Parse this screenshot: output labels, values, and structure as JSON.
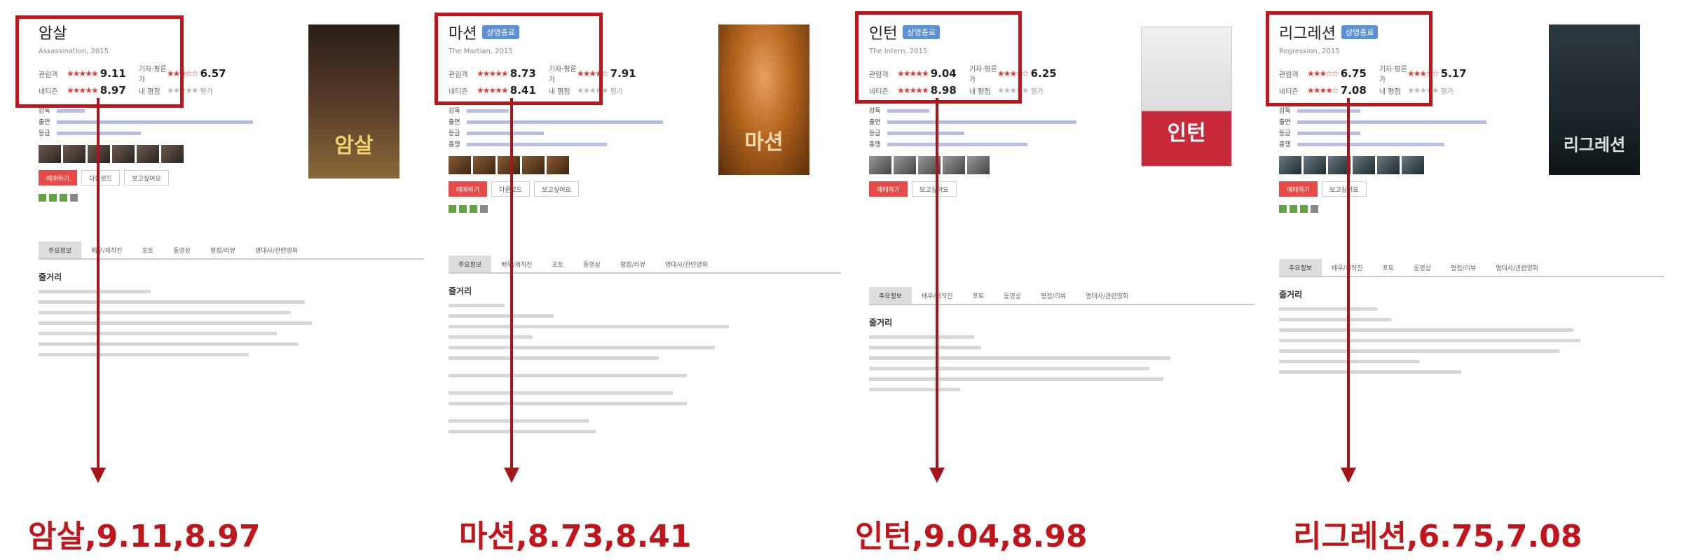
{
  "panels": [
    {
      "title": "암살",
      "badge": "",
      "subtitle": "Assassination, 2015",
      "ratings": {
        "row1": {
          "label": "관람객",
          "score": "9.11",
          "label2": "기자·평론가",
          "score2": "6.57"
        },
        "row2": {
          "label": "네티즌",
          "score": "8.97",
          "label2": "내 평점",
          "score2": "평가"
        }
      },
      "meta_keys": [
        "감독",
        "출연",
        "등급"
      ],
      "buttons": {
        "primary": "예매하기",
        "secondary": "다운로드",
        "third": "보고싶어요"
      },
      "tabs": [
        "주요정보",
        "배우/제작진",
        "포토",
        "동영상",
        "평점/리뷰",
        "명대사/관련영화"
      ],
      "synopsis_heading": "줄거리",
      "poster_title": "암살",
      "result": "암살,9.11,8.97",
      "colors": {
        "poster_bg": "#3a2b22",
        "poster_accent": "#c8a050"
      }
    },
    {
      "title": "마션",
      "badge": "상영종료",
      "subtitle": "The Martian, 2015",
      "ratings": {
        "row1": {
          "label": "관람객",
          "score": "8.73",
          "label2": "기자·평론가",
          "score2": "7.91"
        },
        "row2": {
          "label": "네티즌",
          "score": "8.41",
          "label2": "내 평점",
          "score2": "평가"
        }
      },
      "meta_keys": [
        "감독",
        "출연",
        "등급",
        "흥행"
      ],
      "buttons": {
        "primary": "예매하기",
        "secondary": "다운로드",
        "third": "보고싶어요"
      },
      "tabs": [
        "주요정보",
        "배우/제작진",
        "포토",
        "동영상",
        "평점/리뷰",
        "명대사/관련영화"
      ],
      "synopsis_heading": "줄거리",
      "poster_title": "마션",
      "result": "마션,8.73,8.41",
      "colors": {
        "poster_bg": "#b5651d",
        "poster_accent": "#e5904a"
      }
    },
    {
      "title": "인턴",
      "badge": "상영종료",
      "subtitle": "The Intern, 2015",
      "ratings": {
        "row1": {
          "label": "관람객",
          "score": "9.04",
          "label2": "기자·평론가",
          "score2": "6.25"
        },
        "row2": {
          "label": "네티즌",
          "score": "8.98",
          "label2": "내 평점",
          "score2": "평가"
        }
      },
      "meta_keys": [
        "감독",
        "출연",
        "등급",
        "흥행"
      ],
      "buttons": {
        "primary": "예매하기",
        "secondary": "보고싶어요",
        "third": ""
      },
      "tabs": [
        "주요정보",
        "배우/제작진",
        "포토",
        "동영상",
        "평점/리뷰",
        "명대사/관련영화"
      ],
      "synopsis_heading": "줄거리",
      "poster_title": "인턴",
      "result": "인턴,9.04,8.98",
      "colors": {
        "poster_bg": "#e9e9e9",
        "poster_accent": "#cc2233"
      }
    },
    {
      "title": "리그레션",
      "badge": "상영종료",
      "subtitle": "Regression, 2015",
      "ratings": {
        "row1": {
          "label": "관람객",
          "score": "6.75",
          "label2": "기자·평론가",
          "score2": "5.17"
        },
        "row2": {
          "label": "네티즌",
          "score": "7.08",
          "label2": "내 평점",
          "score2": "평가"
        }
      },
      "meta_keys": [
        "감독",
        "출연",
        "등급",
        "흥행"
      ],
      "buttons": {
        "primary": "예매하기",
        "secondary": "보고싶어요",
        "third": ""
      },
      "tabs": [
        "주요정보",
        "배우/제작진",
        "포토",
        "동영상",
        "평점/리뷰",
        "명대사/관련영화"
      ],
      "synopsis_heading": "줄거리",
      "poster_title": "리그레션",
      "result": "리그레션,6.75,7.08",
      "colors": {
        "poster_bg": "#1e2a30",
        "poster_accent": "#8ea0a8"
      }
    }
  ]
}
